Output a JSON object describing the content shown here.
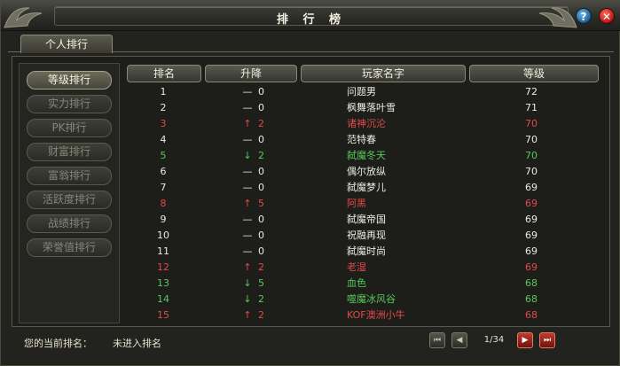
{
  "window": {
    "title": "排 行 榜"
  },
  "tabs": [
    {
      "label": "个人排行",
      "active": true
    }
  ],
  "categories": [
    {
      "label": "等级排行",
      "active": true
    },
    {
      "label": "实力排行",
      "active": false
    },
    {
      "label": "PK排行",
      "active": false
    },
    {
      "label": "财富排行",
      "active": false
    },
    {
      "label": "富翁排行",
      "active": false
    },
    {
      "label": "活跃度排行",
      "active": false
    },
    {
      "label": "战绩排行",
      "active": false
    },
    {
      "label": "荣誉值排行",
      "active": false
    }
  ],
  "table": {
    "headers": {
      "rank": "排名",
      "change": "升降",
      "name": "玩家名字",
      "level": "等级"
    },
    "rows": [
      {
        "rank": "1",
        "arrow": "—",
        "change": "0",
        "name": "问题男",
        "level": "72",
        "status": "normal"
      },
      {
        "rank": "2",
        "arrow": "—",
        "change": "0",
        "name": "枫舞落叶雪",
        "level": "71",
        "status": "normal"
      },
      {
        "rank": "3",
        "arrow": "↑",
        "change": "2",
        "name": "诸神沉沦",
        "level": "70",
        "status": "up"
      },
      {
        "rank": "4",
        "arrow": "—",
        "change": "0",
        "name": "范特春",
        "level": "70",
        "status": "normal"
      },
      {
        "rank": "5",
        "arrow": "↓",
        "change": "2",
        "name": "弑魔冬天",
        "level": "70",
        "status": "down"
      },
      {
        "rank": "6",
        "arrow": "—",
        "change": "0",
        "name": "偶尔放纵",
        "level": "70",
        "status": "normal"
      },
      {
        "rank": "7",
        "arrow": "—",
        "change": "0",
        "name": "弑魔梦儿",
        "level": "69",
        "status": "normal"
      },
      {
        "rank": "8",
        "arrow": "↑",
        "change": "5",
        "name": "阿黑",
        "level": "69",
        "status": "up"
      },
      {
        "rank": "9",
        "arrow": "—",
        "change": "0",
        "name": "弑魔帝国",
        "level": "69",
        "status": "normal"
      },
      {
        "rank": "10",
        "arrow": "—",
        "change": "0",
        "name": "祝融再现",
        "level": "69",
        "status": "normal"
      },
      {
        "rank": "11",
        "arrow": "—",
        "change": "0",
        "name": "弑魔时尚",
        "level": "69",
        "status": "normal"
      },
      {
        "rank": "12",
        "arrow": "↑",
        "change": "2",
        "name": "老湿",
        "level": "69",
        "status": "up"
      },
      {
        "rank": "13",
        "arrow": "↓",
        "change": "5",
        "name": "血色",
        "level": "68",
        "status": "down"
      },
      {
        "rank": "14",
        "arrow": "↓",
        "change": "2",
        "name": "噬魔冰风谷",
        "level": "68",
        "status": "down"
      },
      {
        "rank": "15",
        "arrow": "↑",
        "change": "2",
        "name": "KOF澳洲小牛",
        "level": "68",
        "status": "up"
      }
    ]
  },
  "footer": {
    "current_rank_label": "您的当前排名：",
    "current_rank_value": "未进入排名",
    "page_indicator": "1/34"
  },
  "colors": {
    "normal": "#ecebe3",
    "up": "#e04a4a",
    "down": "#58c85a"
  },
  "icons": {
    "help": "help-icon",
    "close": "close-icon",
    "first": "first-page-icon",
    "prev": "prev-page-icon",
    "next": "next-page-icon",
    "last": "last-page-icon"
  }
}
